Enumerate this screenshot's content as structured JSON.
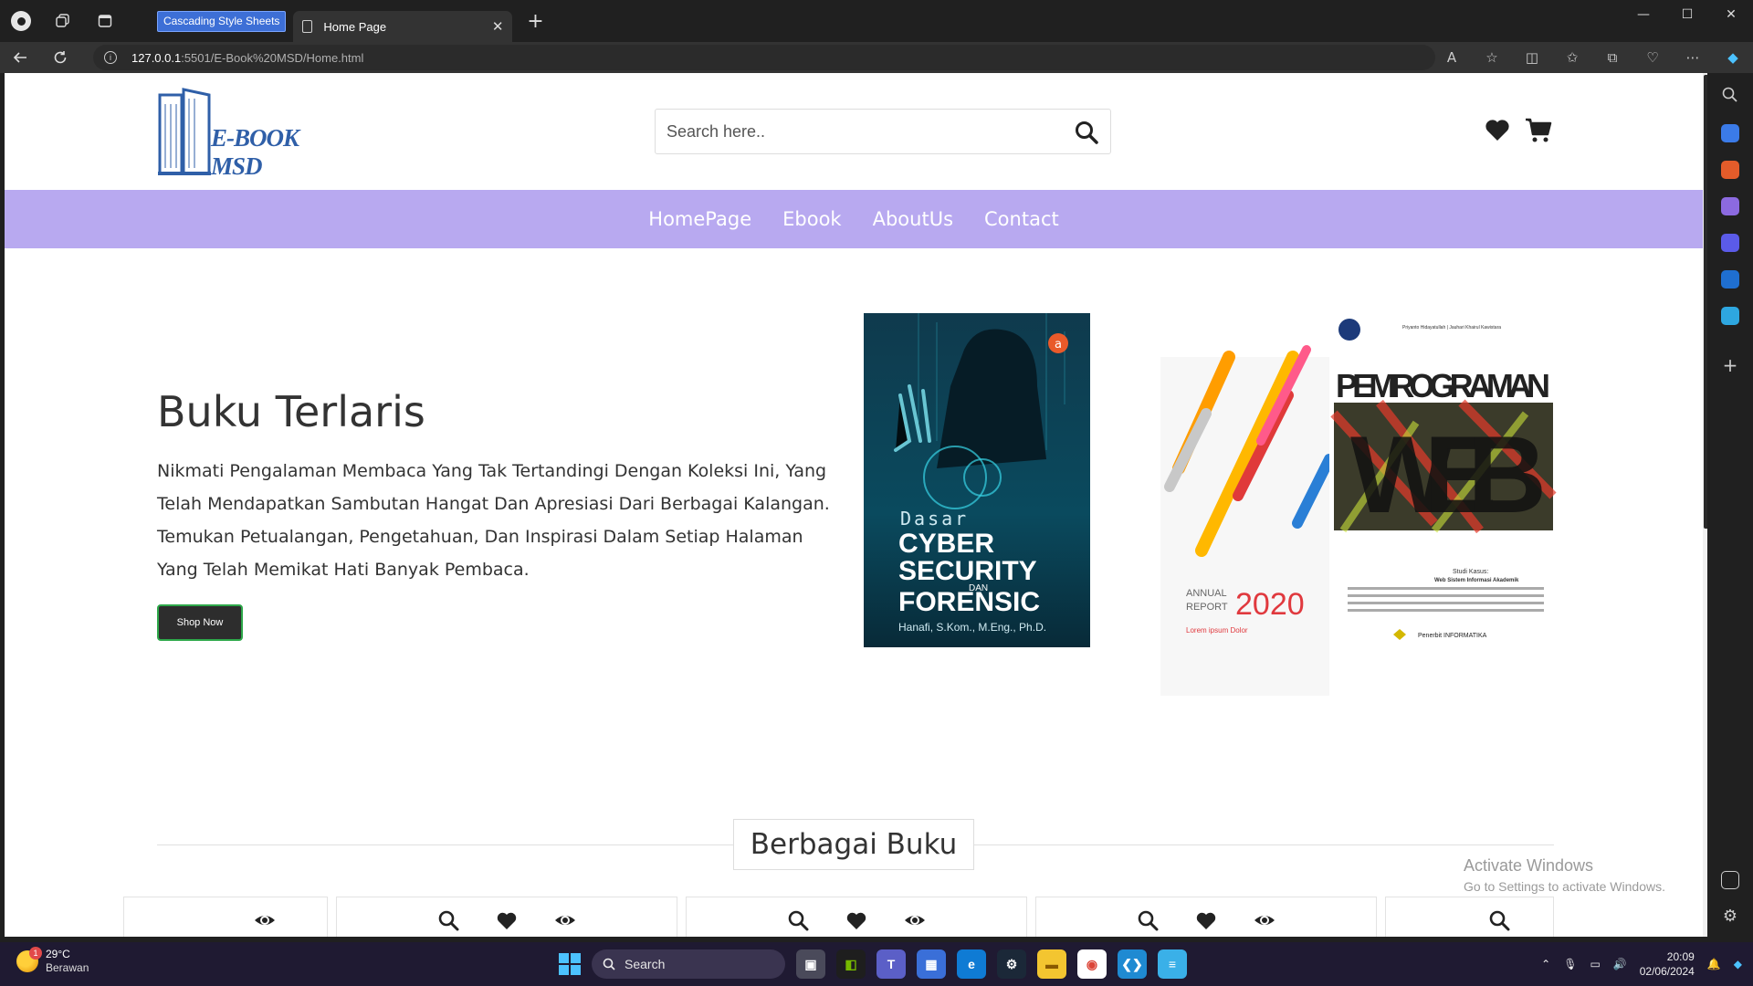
{
  "browser": {
    "tab_inactive_label": "Cascading Style Sheets",
    "tab_active_label": "Home Page",
    "tab_close_glyph": "✕",
    "new_tab_glyph": "+",
    "url_host": "127.0.0.1",
    "url_path": ":5501/E-Book%20MSD/Home.html"
  },
  "site": {
    "logo_text": "E-BOOK MSD",
    "search_placeholder": "Search here..",
    "nav": [
      "HomePage",
      "Ebook",
      "AboutUs",
      "Contact"
    ],
    "hero": {
      "title": "Buku Terlaris",
      "text": "Nikmati Pengalaman Membaca Yang Tak Tertandingi Dengan Koleksi Ini, Yang Telah Mendapatkan Sambutan Hangat Dan Apresiasi Dari Berbagai Kalangan. Temukan Petualangan, Pengetahuan, Dan Inspirasi Dalam Setiap Halaman Yang Telah Memikat Hati Banyak Pembaca.",
      "button": "Shop Now"
    },
    "book1": {
      "line1": "Dasar",
      "line2": "CYBER",
      "line3": "SECURITY",
      "line4": "DAN",
      "line5": "FORENSIC",
      "author": "Hanafi, S.Kom., M.Eng., Ph.D."
    },
    "book2": {
      "annual": "ANNUAL",
      "report": "REPORT",
      "year": "2020",
      "lorem": "Lorem ipsum Dolor",
      "title": "PEMROGRAMAN",
      "web": "WEB",
      "authors": "Priyanto Hidayatullah | Jauhari Khairul Kawistara",
      "studi": "Studi Kasus:",
      "studi2": "Web Sistem Informasi Akademik",
      "publisher": "Penerbit INFORMATIKA"
    },
    "section_title": "Berbagai Buku",
    "colors": {
      "nav_bg": "#b8a9f0",
      "logo_blue": "#2f5fa8",
      "button_border": "#2ea84a"
    }
  },
  "watermark": {
    "line1": "Activate Windows",
    "line2": "Go to Settings to activate Windows."
  },
  "taskbar": {
    "temp": "29°C",
    "condition": "Berawan",
    "weather_badge": "1",
    "search_label": "Search",
    "time": "20:09",
    "date": "02/06/2024"
  }
}
